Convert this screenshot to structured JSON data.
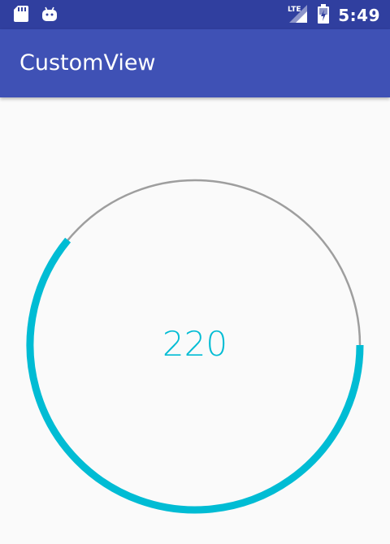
{
  "status_bar": {
    "time": "5:49",
    "network_label": "LTE",
    "icons": [
      "sd-card-icon",
      "android-icon",
      "lte-signal-icon",
      "battery-icon"
    ]
  },
  "app_bar": {
    "title": "CustomView"
  },
  "dial": {
    "value": "220",
    "progress_fraction": 0.61,
    "colors": {
      "progress": "#00bcd4",
      "track": "#9e9e9e",
      "value_text": "#00bcd4"
    }
  },
  "colors": {
    "status_bar": "#303f9f",
    "app_bar": "#3f51b5",
    "background": "#fafafa"
  }
}
